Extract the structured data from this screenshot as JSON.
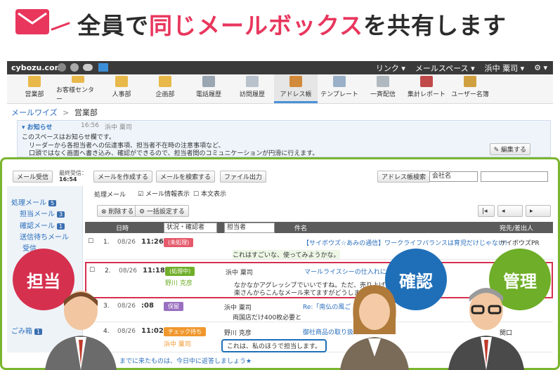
{
  "headline": {
    "pre": "全員で",
    "highlight": "同じメールボックス",
    "post": "を共有します"
  },
  "topbar": {
    "logo": "cybozu.com",
    "links": "リンク ▾",
    "space": "メールスペース ▾",
    "user": "浜中 粟司 ▾",
    "gear": "⚙ ▾"
  },
  "appnav": {
    "items": [
      "営業部",
      "お客様センター",
      "人事部",
      "企画部",
      "電話履歴",
      "訪問履歴",
      "アドレス帳",
      "テンプレート",
      "一斉配信",
      "集計レポート",
      "ユーザー名簿"
    ]
  },
  "breadcrumb": {
    "root": "メールワイズ",
    "sep": ">",
    "current": "営業部"
  },
  "notice": {
    "title": "▾ お知らせ",
    "time": "16:56",
    "author": "浜中 粟司",
    "lines": [
      "このスペースはお知らせ欄です。",
      "リーダーから各担当者への伝達事項、担当者不在時の注意事項など、",
      "口頭ではなく画面へ書き込み、確認ができるので、担当者間のコミュニケーションが円滑に行えます。"
    ],
    "edit": "✎ 編集する"
  },
  "toolbar": {
    "receive": "メール受信",
    "last_label": "最終受信：",
    "last_time": "16:54",
    "compose": "メールを作成する",
    "search": "メールを検索する",
    "export": "ファイル出力",
    "addr_search": "アドレス帳検索",
    "company": "会社名",
    "search_value": ""
  },
  "sidebar": {
    "inbox": "処理メール",
    "inbox_count": "5",
    "mine": "担当メール",
    "mine_count": "3",
    "confirm": "確認メール",
    "confirm_count": "1",
    "sending": "送信待ちメール",
    "received": "受信",
    "trash": "ごみ箱",
    "trash_count": "1"
  },
  "list": {
    "view_label": "処理メール",
    "info_label": "メール情報表示",
    "body_label": "本文表示",
    "delete": "⊗ 削除する",
    "bulk": "⚙ 一括設定する",
    "col_date": "日時",
    "col_status": "状況・確認者",
    "col_assignee": "担当者",
    "col_subject": "件名",
    "col_from": "宛先/差出人",
    "rows": [
      {
        "num": "1.",
        "date": "08/26",
        "time": "11:26",
        "status": "(未処理)",
        "assignee": "",
        "subject": "【サイボウズ☆あみの通信】ワークライフバランスは育児だけじゃない！",
        "from": "サイボウズPR",
        "comment": "これはすごいな、使ってみようかな。"
      },
      {
        "num": "2.",
        "date": "08/26",
        "time": "11:18",
        "status": "(処理中)",
        "sub": "野川 克彦",
        "assignee": "浜中 粟司",
        "subject": "マールライスシーの仕入れに",
        "from": "",
        "comment": "なかなかアグレッシブでいいですね。ただ、売り上げ目...そこを掴",
        "comment2": "楽さんからこんなメール来てますがどうしましょう。"
      },
      {
        "num": "3.",
        "date": "08/26",
        "time": ":08",
        "status": "保留",
        "assignee": "浜中 粟司",
        "subject": "Re:「南仏の風ご",
        "from": "",
        "comment": "両国店だけ400枚必要と"
      },
      {
        "num": "4.",
        "date": "08/26",
        "time": "11:02",
        "status": "チェック待ち",
        "sub": "浜中 粟司",
        "assignee": "野川 克彦",
        "subject": "御社商品の取り扱い",
        "from": "関口",
        "comment": "これは、私のほうで担当します。"
      }
    ],
    "footer": "までに来たものは、今日中に返答しましょう★"
  },
  "roles": {
    "tanto": "担当",
    "kakunin": "確認",
    "kanri": "管理"
  },
  "colors": {
    "accent": "#e8365d",
    "green": "#7ab52f",
    "red": "#d6304f",
    "blue": "#1f6fb8",
    "lime": "#6fae28"
  }
}
